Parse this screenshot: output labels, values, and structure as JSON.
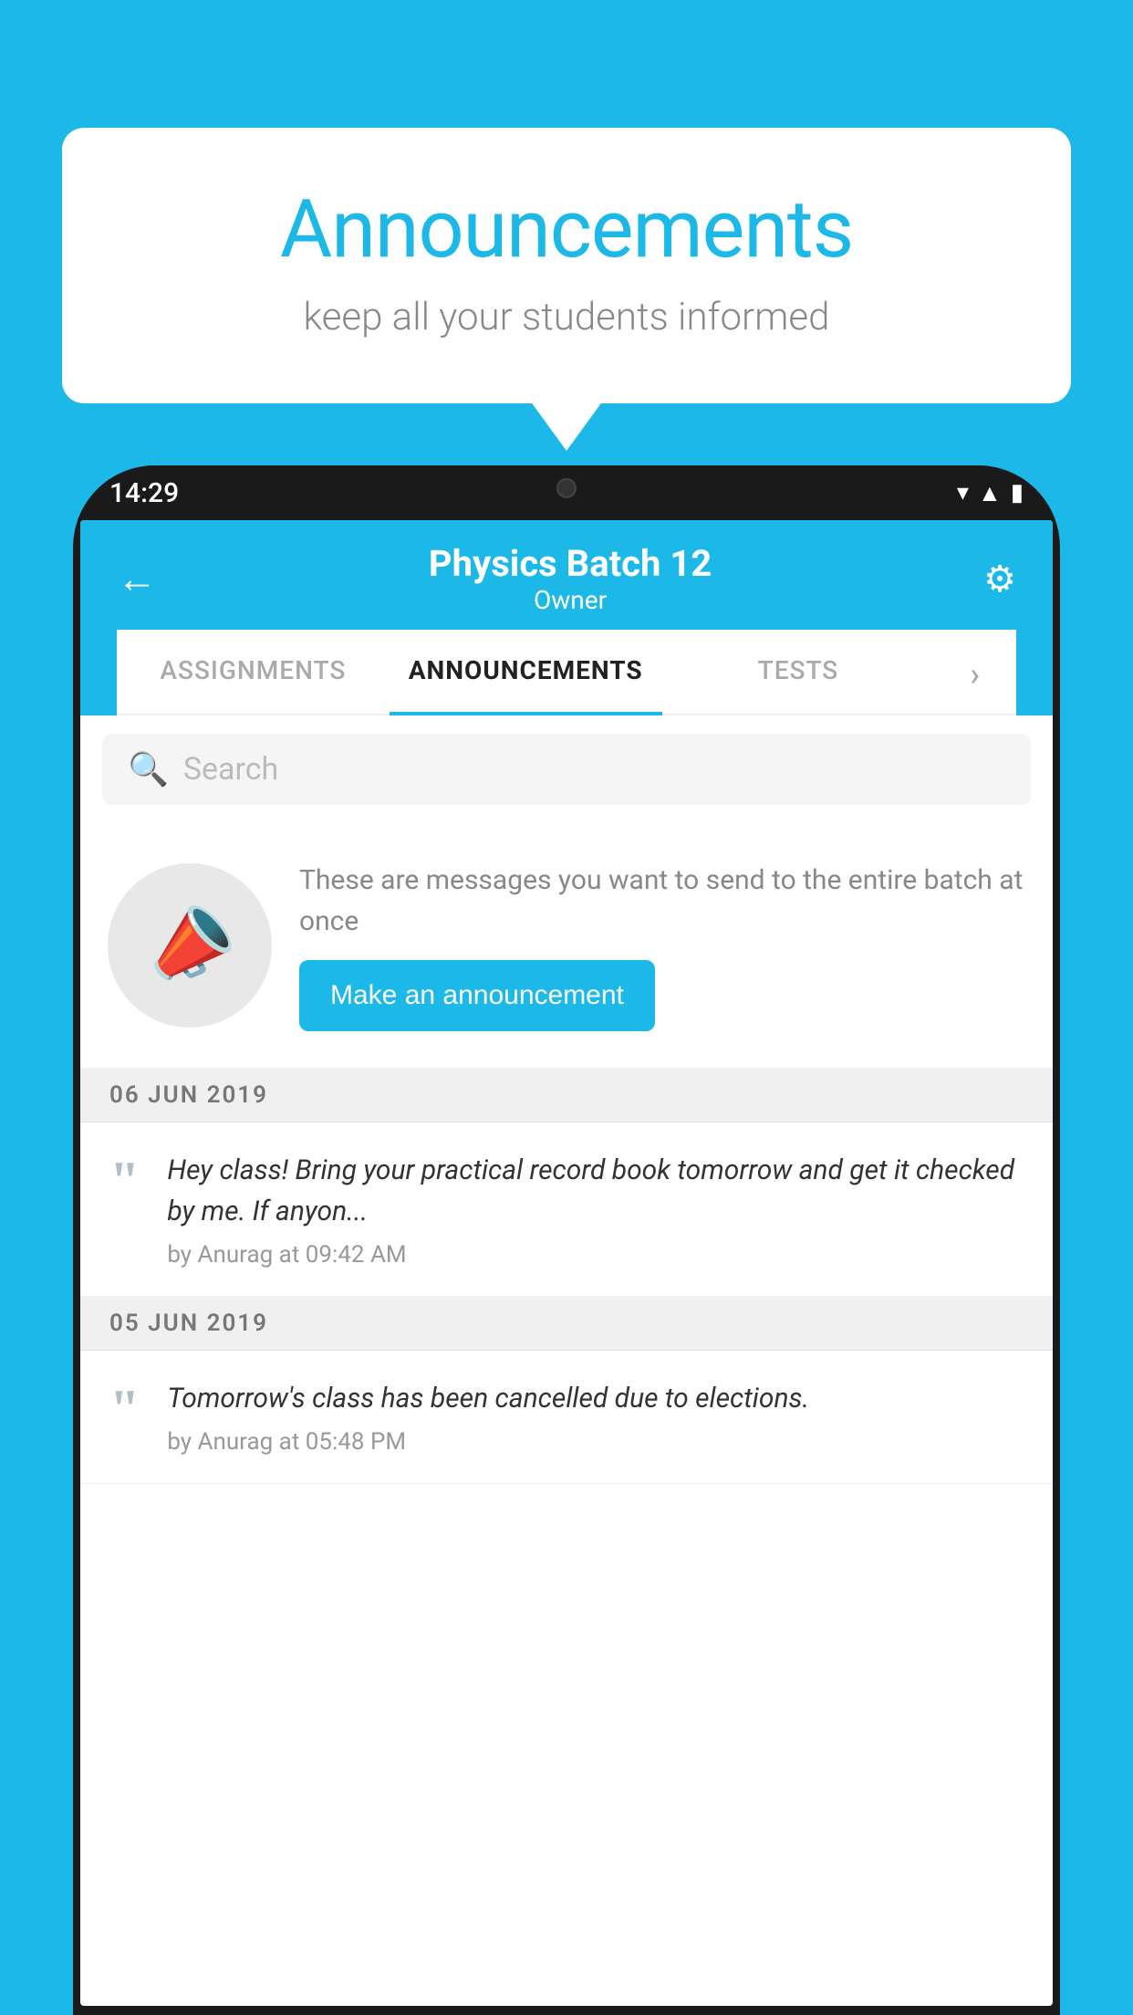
{
  "background_color": "#1bb8e8",
  "speech_bubble": {
    "title": "Announcements",
    "subtitle": "keep all your students informed"
  },
  "phone": {
    "status_bar": {
      "time": "14:29",
      "icons": [
        "wifi",
        "signal",
        "battery"
      ]
    },
    "header": {
      "batch_name": "Physics Batch 12",
      "owner_label": "Owner",
      "back_label": "←",
      "settings_label": "⚙"
    },
    "tabs": [
      {
        "label": "ASSIGNMENTS",
        "active": false
      },
      {
        "label": "ANNOUNCEMENTS",
        "active": true
      },
      {
        "label": "TESTS",
        "active": false
      },
      {
        "label": "›",
        "active": false
      }
    ],
    "search": {
      "placeholder": "Search"
    },
    "promo": {
      "description": "These are messages you want to send to the entire batch at once",
      "button_label": "Make an announcement"
    },
    "announcements": [
      {
        "date": "06  JUN  2019",
        "text": "Hey class! Bring your practical record book tomorrow and get it checked by me. If anyon...",
        "meta": "by Anurag at 09:42 AM"
      },
      {
        "date": "05  JUN  2019",
        "text": "Tomorrow's class has been cancelled due to elections.",
        "meta": "by Anurag at 05:48 PM"
      }
    ]
  }
}
